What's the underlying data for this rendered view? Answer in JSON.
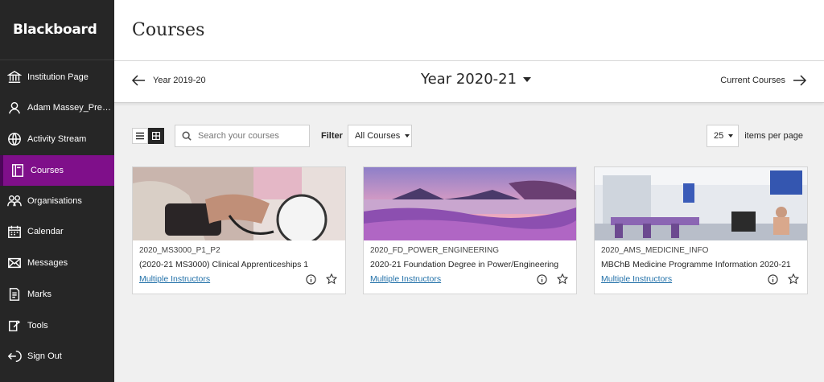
{
  "brand": {
    "name": "Blackboard"
  },
  "sidebar": {
    "items": [
      {
        "label": "Institution Page",
        "icon": "institution-icon"
      },
      {
        "label": "Adam Massey_Previ...",
        "icon": "user-icon"
      },
      {
        "label": "Activity Stream",
        "icon": "globe-icon"
      },
      {
        "label": "Courses",
        "icon": "courses-icon",
        "active": true
      },
      {
        "label": "Organisations",
        "icon": "organisations-icon"
      },
      {
        "label": "Calendar",
        "icon": "calendar-icon"
      },
      {
        "label": "Messages",
        "icon": "messages-icon"
      },
      {
        "label": "Marks",
        "icon": "marks-icon"
      },
      {
        "label": "Tools",
        "icon": "tools-icon"
      },
      {
        "label": "Sign Out",
        "icon": "sign-out-icon"
      }
    ]
  },
  "header": {
    "title": "Courses"
  },
  "term": {
    "previous": "Year 2019-20",
    "current": "Year 2020-21",
    "next": "Current Courses"
  },
  "toolbar": {
    "search_placeholder": "Search your courses",
    "filter_label": "Filter",
    "filter_value": "All Courses",
    "per_page_value": "25",
    "per_page_label": "items per page"
  },
  "courses": [
    {
      "id": "2020_MS3000_P1_P2",
      "title": "(2020-21 MS3000) Clinical Apprenticeships 1",
      "instructors": "Multiple Instructors"
    },
    {
      "id": "2020_FD_POWER_ENGINEERING",
      "title": "2020-21 Foundation Degree in Power/Engineering",
      "instructors": "Multiple Instructors"
    },
    {
      "id": "2020_AMS_MEDICINE_INFO",
      "title": "MBChB Medicine Programme Information 2020-21",
      "instructors": "Multiple Instructors"
    }
  ],
  "colors": {
    "sidebar_bg": "#262626",
    "active_item": "#7f0f8a",
    "link": "#2170a8"
  }
}
